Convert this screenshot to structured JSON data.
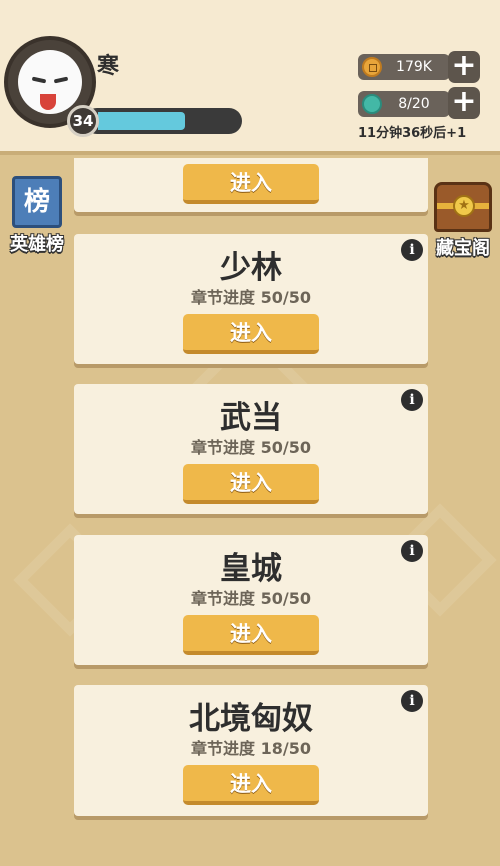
{
  "player": {
    "name": "寒",
    "level": "34",
    "xp_fraction": 0.62
  },
  "resources": {
    "gold": "179K",
    "stamina": "8/20",
    "stamina_timer": "11分钟36秒后+1"
  },
  "side": {
    "left_label": "英雄榜",
    "left_icon_text": "榜",
    "right_label": "藏宝阁"
  },
  "cards": {
    "top": {
      "enter_label": "进入"
    },
    "items": [
      {
        "title": "少林",
        "progress": "章节进度 50/50",
        "enter_label": "进入"
      },
      {
        "title": "武当",
        "progress": "章节进度 50/50",
        "enter_label": "进入"
      },
      {
        "title": "皇城",
        "progress": "章节进度 50/50",
        "enter_label": "进入"
      },
      {
        "title": "北境匈奴",
        "progress": "章节进度 18/50",
        "enter_label": "进入"
      }
    ]
  },
  "icons": {
    "plus": "+",
    "info": "i",
    "star": "★"
  },
  "colors": {
    "background": "#dbc28e",
    "card": "#f8f0de",
    "button": "#efb84a",
    "xp_fill": "#64c9dd"
  }
}
